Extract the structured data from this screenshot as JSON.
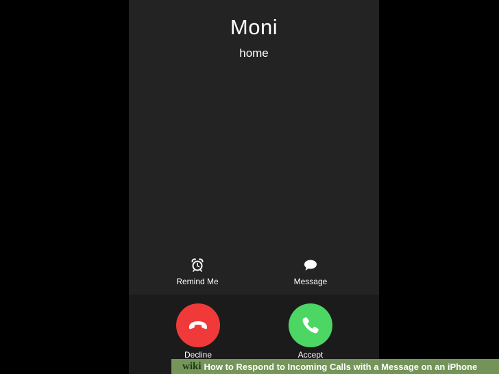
{
  "caller": {
    "name": "Moni",
    "label": "home"
  },
  "options": {
    "remind": {
      "label": "Remind Me",
      "icon": "alarm-clock-icon"
    },
    "message": {
      "label": "Message",
      "icon": "speech-bubble-icon"
    }
  },
  "actions": {
    "decline": {
      "label": "Decline",
      "icon": "phone-hangup-icon",
      "color": "#f03a3a"
    },
    "accept": {
      "label": "Accept",
      "icon": "phone-icon",
      "color": "#4cd664"
    }
  },
  "banner": {
    "logo": "wiki",
    "title": "How to Respond to Incoming Calls with a Message on an iPhone",
    "color": "#7da05f"
  }
}
